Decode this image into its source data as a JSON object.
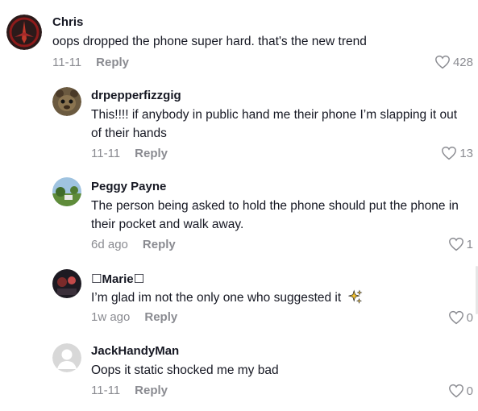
{
  "comments": [
    {
      "author": "Chris",
      "text": "oops dropped the phone super hard. that's the new trend",
      "date": "11-11",
      "reply_label": "Reply",
      "likes": "428",
      "avatar_icon": "sith-emblem-avatar"
    },
    {
      "author": "drpepperfizzgig",
      "text": "This!!!! if anybody in public hand me their phone I’m slapping it out of their hands",
      "date": "11-11",
      "reply_label": "Reply",
      "likes": "13",
      "avatar_icon": "plush-character-avatar"
    },
    {
      "author": "Peggy Payne",
      "text": "The person being asked to hold the phone should put the phone in their pocket and walk away.",
      "date": "6d ago",
      "reply_label": "Reply",
      "likes": "1",
      "avatar_icon": "landscape-photo-avatar"
    },
    {
      "author": "☐Marie☐",
      "text": "I’m glad im not the only one who suggested it",
      "date": "1w ago",
      "reply_label": "Reply",
      "likes": "0",
      "avatar_icon": "dark-photo-avatar",
      "emoji": "sparkles"
    },
    {
      "author": "JackHandyMan",
      "text": "Oops it static shocked me my bad",
      "date": "11-11",
      "reply_label": "Reply",
      "likes": "0",
      "avatar_icon": "default-person-avatar"
    }
  ],
  "colors": {
    "text": "#161823",
    "muted": "#8a8b91"
  }
}
